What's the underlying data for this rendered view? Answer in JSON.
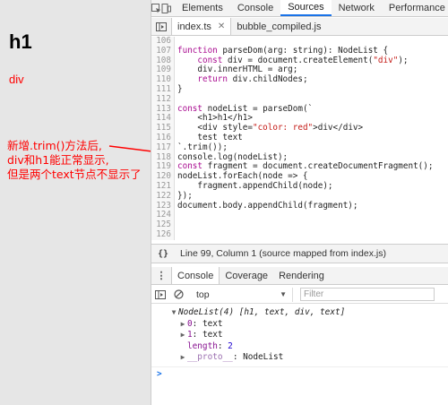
{
  "page": {
    "h1_text": "h1",
    "div_text": "div",
    "annotation_lines": [
      "新增.trim()方法后,",
      "div和h1能正常显示,",
      "但是两个text节点不显示了"
    ],
    "accent_color": "#ff0000"
  },
  "devtools": {
    "tabs": [
      "Elements",
      "Console",
      "Sources",
      "Network",
      "Performance"
    ],
    "active_tab": "Sources",
    "file_tabs": [
      "index.ts",
      "bubble_compiled.js"
    ],
    "active_file": "index.ts",
    "code_lines": [
      {
        "ln": "106",
        "text": ""
      },
      {
        "ln": "107",
        "text": "function parseDom(arg: string): NodeList {"
      },
      {
        "ln": "108",
        "text": "    const div = document.createElement(\"div\");"
      },
      {
        "ln": "109",
        "text": "    div.innerHTML = arg;"
      },
      {
        "ln": "110",
        "text": "    return div.childNodes;"
      },
      {
        "ln": "111",
        "text": "}"
      },
      {
        "ln": "112",
        "text": ""
      },
      {
        "ln": "113",
        "text": "const nodeList = parseDom(`"
      },
      {
        "ln": "114",
        "text": "    <h1>h1</h1>"
      },
      {
        "ln": "115",
        "text": "    <div style=\"color: red\">div</div>"
      },
      {
        "ln": "116",
        "text": "    test text"
      },
      {
        "ln": "117",
        "text": "`.trim());"
      },
      {
        "ln": "118",
        "text": "console.log(nodeList);"
      },
      {
        "ln": "119",
        "text": "const fragment = document.createDocumentFragment();"
      },
      {
        "ln": "120",
        "text": "nodeList.forEach(node => {"
      },
      {
        "ln": "121",
        "text": "    fragment.appendChild(node);"
      },
      {
        "ln": "122",
        "text": "});"
      },
      {
        "ln": "123",
        "text": "document.body.appendChild(fragment);"
      },
      {
        "ln": "124",
        "text": ""
      },
      {
        "ln": "125",
        "text": ""
      },
      {
        "ln": "126",
        "text": ""
      }
    ],
    "status": {
      "braces": "{}",
      "text": "Line 99, Column 1   (source mapped from index.js)"
    },
    "drawer_tabs": [
      "Console",
      "Coverage",
      "Rendering"
    ],
    "active_drawer_tab": "Console",
    "console_context": "top",
    "filter_placeholder": "Filter",
    "console": {
      "summary": "NodeList(4) [h1, text, div, text]",
      "items": [
        {
          "name": "0",
          "value": "text"
        },
        {
          "name": "1",
          "value": "text"
        },
        {
          "name": "length",
          "value": "2"
        },
        {
          "name": "__proto__",
          "value": "NodeList"
        }
      ],
      "prompt": ">"
    }
  }
}
